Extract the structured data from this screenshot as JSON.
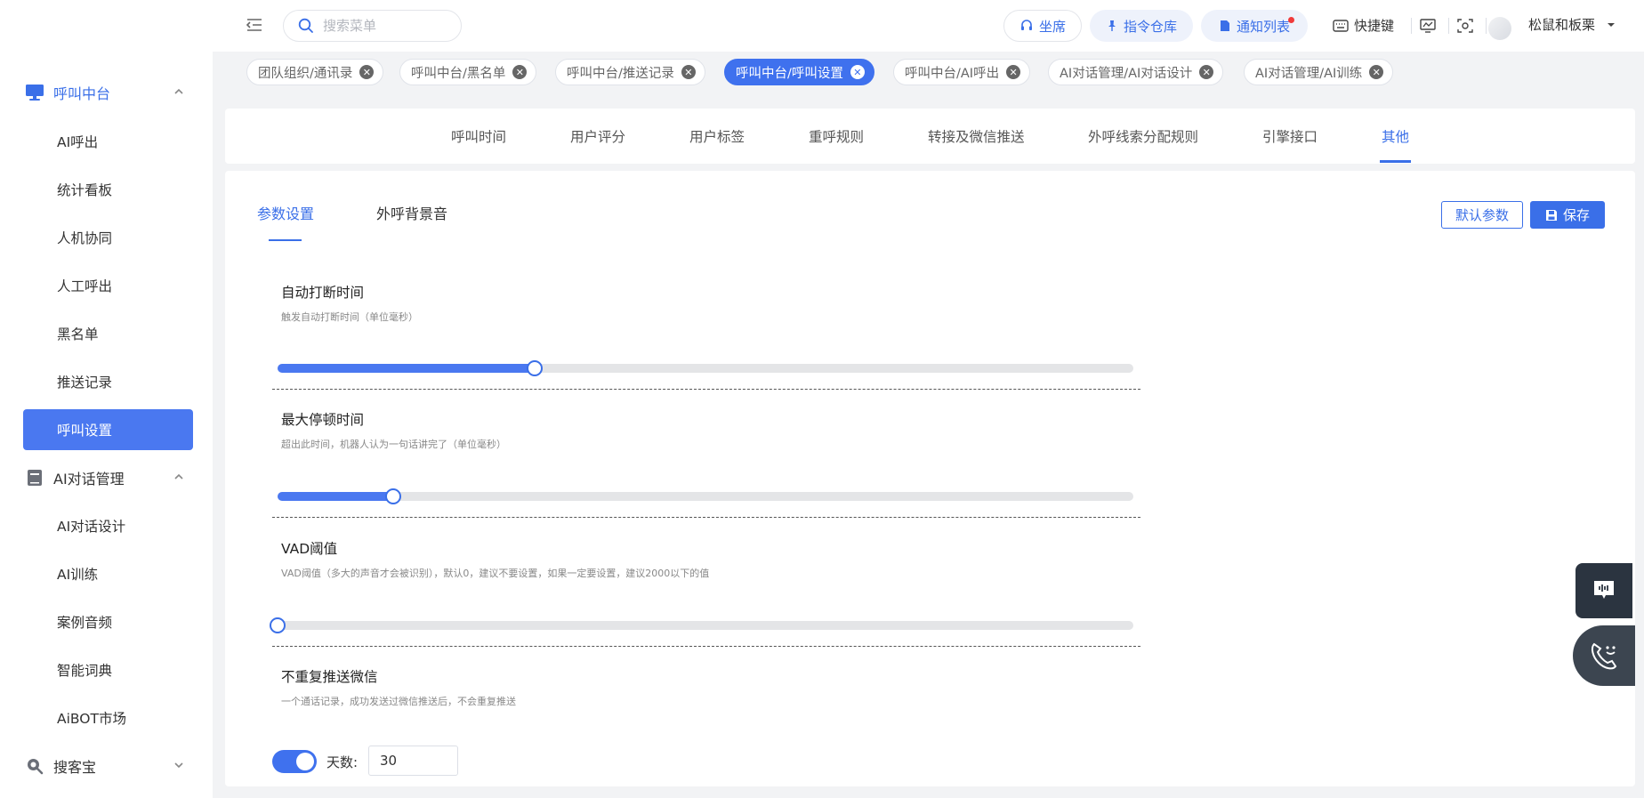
{
  "sidebar": {
    "groups": [
      {
        "label": "呼叫中台",
        "icon": "monitor-icon"
      },
      {
        "label": "AI对话管理",
        "icon": "book-icon"
      },
      {
        "label": "搜客宝",
        "icon": "search-magnify-icon"
      }
    ],
    "items": [
      "AI呼出",
      "统计看板",
      "人机协同",
      "人工呼出",
      "黑名单",
      "推送记录",
      "呼叫设置",
      "AI对话设计",
      "AI训练",
      "案例音频",
      "智能词典",
      "AiBOT市场"
    ]
  },
  "header": {
    "search_placeholder": "搜索菜单",
    "seat": "坐席",
    "command_repo": "指令仓库",
    "notify_list": "通知列表",
    "shortcut": "快捷键",
    "username": "松鼠和板栗"
  },
  "tags": [
    {
      "label": "团队组织/通讯录"
    },
    {
      "label": "呼叫中台/黑名单"
    },
    {
      "label": "呼叫中台/推送记录"
    },
    {
      "label": "呼叫中台/呼叫设置"
    },
    {
      "label": "呼叫中台/AI呼出"
    },
    {
      "label": "AI对话管理/AI对话设计"
    },
    {
      "label": "AI对话管理/AI训练"
    }
  ],
  "top_tabs": [
    "呼叫时间",
    "用户评分",
    "用户标签",
    "重呼规则",
    "转接及微信推送",
    "外呼线索分配规则",
    "引擎接口",
    "其他"
  ],
  "sub_tabs": [
    "参数设置",
    "外呼背景音"
  ],
  "buttons": {
    "default_params": "默认参数",
    "save": "保存"
  },
  "settings": [
    {
      "title": "自动打断时间",
      "desc": "触发自动打断时间（单位毫秒）",
      "level": 0.3
    },
    {
      "title": "最大停顿时间",
      "desc": "超出此时间，机器人认为一句话讲完了（单位毫秒）",
      "level": 0.135
    },
    {
      "title": "VAD阈值",
      "desc": "VAD阈值（多大的声音才会被识别），默认0，建议不要设置，如果一定要设置，建议2000以下的值",
      "level": 0
    },
    {
      "title": "不重复推送微信",
      "desc": "一个通话记录，成功发送过微信推送后，不会重复推送"
    }
  ],
  "no_repeat": {
    "enabled": true,
    "days_label": "天数:",
    "days_value": "30"
  },
  "colors": {
    "primary": "#3a6fe8",
    "sidebar_selected": "#4a78f0",
    "notify_dot": "#f03a3a"
  }
}
